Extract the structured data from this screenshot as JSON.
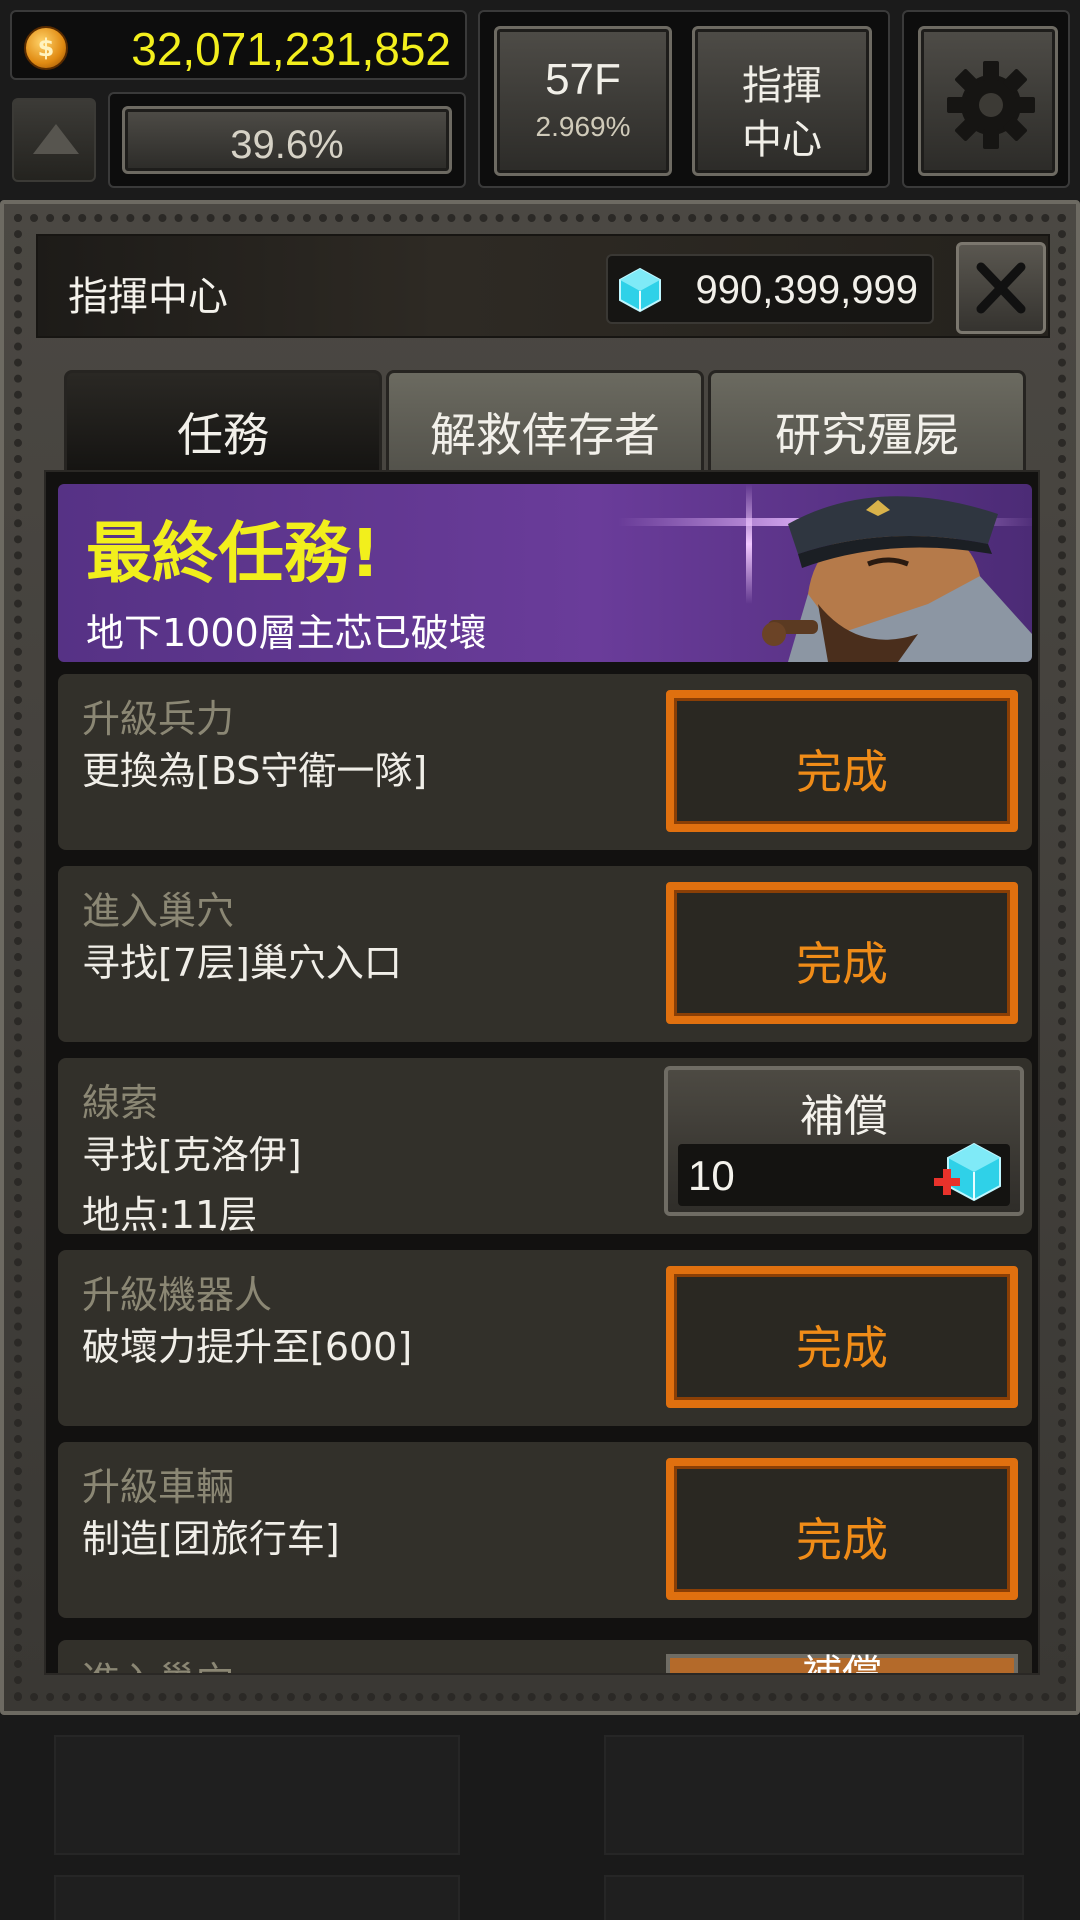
{
  "hud": {
    "gold": "32,071,231,852",
    "progress_percent": "39.6%",
    "floor": "57F",
    "floor_percent": "2.969%",
    "command_center": "指揮\n中心",
    "coin_icon": "coin-icon",
    "settings_icon": "gear-icon"
  },
  "panel": {
    "title": "指揮中心",
    "gems": "990,399,999",
    "tabs": [
      {
        "label": "任務",
        "active": true
      },
      {
        "label": "解救倖存者",
        "active": false
      },
      {
        "label": "研究殭屍",
        "active": false
      }
    ],
    "banner": {
      "title": "最終任務!",
      "subtitle": "地下1000層主芯已破壞"
    },
    "quests": [
      {
        "category": "升級兵力",
        "desc": "更換為[BS守衛一隊]",
        "button": "完成"
      },
      {
        "category": "進入巢穴",
        "desc": "寻找[7层]巢穴入口",
        "button": "完成"
      },
      {
        "category": "線索",
        "desc": "寻找[克洛伊]",
        "desc2": "地点:11层",
        "button": "補償",
        "reward": "10"
      },
      {
        "category": "升級機器人",
        "desc": "破壞力提升至[600]",
        "button": "完成"
      },
      {
        "category": "升級車輛",
        "desc": "制造[团旅行车]",
        "button": "完成"
      },
      {
        "category": "進入巢穴",
        "button": "補償"
      }
    ]
  },
  "colors": {
    "gold_text": "#f3ef1d",
    "done_orange": "#e0700f",
    "banner_purple": "#6a3c9a"
  }
}
